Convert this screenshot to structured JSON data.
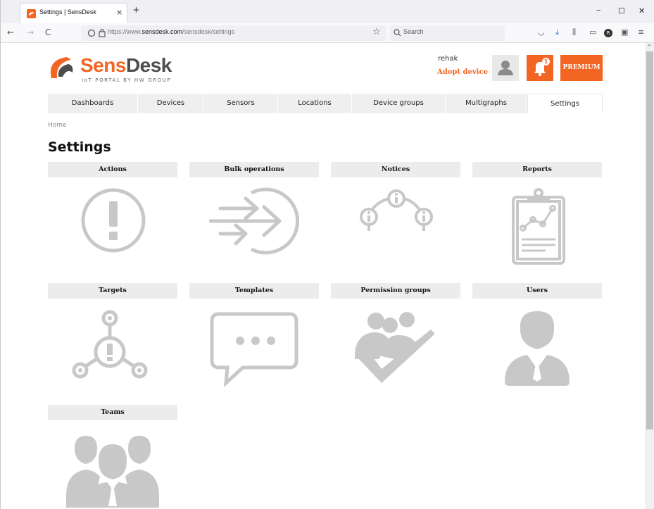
{
  "browser": {
    "tab_title": "Settings | SensDesk",
    "tab_close": "×",
    "new_tab": "+",
    "url_prefix": "https://www.",
    "url_domain": "sensdesk.com",
    "url_path": "/sensdesk/settings",
    "search_placeholder": "Search",
    "window_minimize": "−",
    "window_maximize": "☐",
    "window_close": "✕",
    "back": "←",
    "forward": "→",
    "reload": "C",
    "profile_initial": "R"
  },
  "header": {
    "brand_sens": "Sens",
    "brand_desk": "Desk",
    "tagline": "IoT PORTAL BY HW GROUP",
    "username": "rehak",
    "adopt_device": "Adopt device",
    "notification_count": "1",
    "premium": "PREMIUM"
  },
  "menu": [
    {
      "label": "Dashboards",
      "width": 128
    },
    {
      "label": "Devices",
      "width": 94
    },
    {
      "label": "Sensors",
      "width": 105
    },
    {
      "label": "Locations",
      "width": 105
    },
    {
      "label": "Device groups",
      "width": 133
    },
    {
      "label": "Multigraphs",
      "width": 116
    },
    {
      "label": "Settings",
      "width": 107,
      "active": true
    }
  ],
  "breadcrumb": "Home",
  "page_title": "Settings",
  "cards": [
    {
      "label": "Actions",
      "icon": "exclamation-circle-icon"
    },
    {
      "label": "Bulk operations",
      "icon": "arrows-circle-icon"
    },
    {
      "label": "Notices",
      "icon": "info-nodes-icon"
    },
    {
      "label": "Reports",
      "icon": "clipboard-chart-icon"
    },
    {
      "label": "Targets",
      "icon": "target-network-icon"
    },
    {
      "label": "Templates",
      "icon": "speech-bubble-icon"
    },
    {
      "label": "Permission groups",
      "icon": "group-check-icon"
    },
    {
      "label": "Users",
      "icon": "user-icon"
    },
    {
      "label": "Teams",
      "icon": "team-icon"
    }
  ],
  "colors": {
    "accent": "#f26522",
    "icon_gray": "#c8c8c8",
    "header_gray": "#ececec"
  }
}
